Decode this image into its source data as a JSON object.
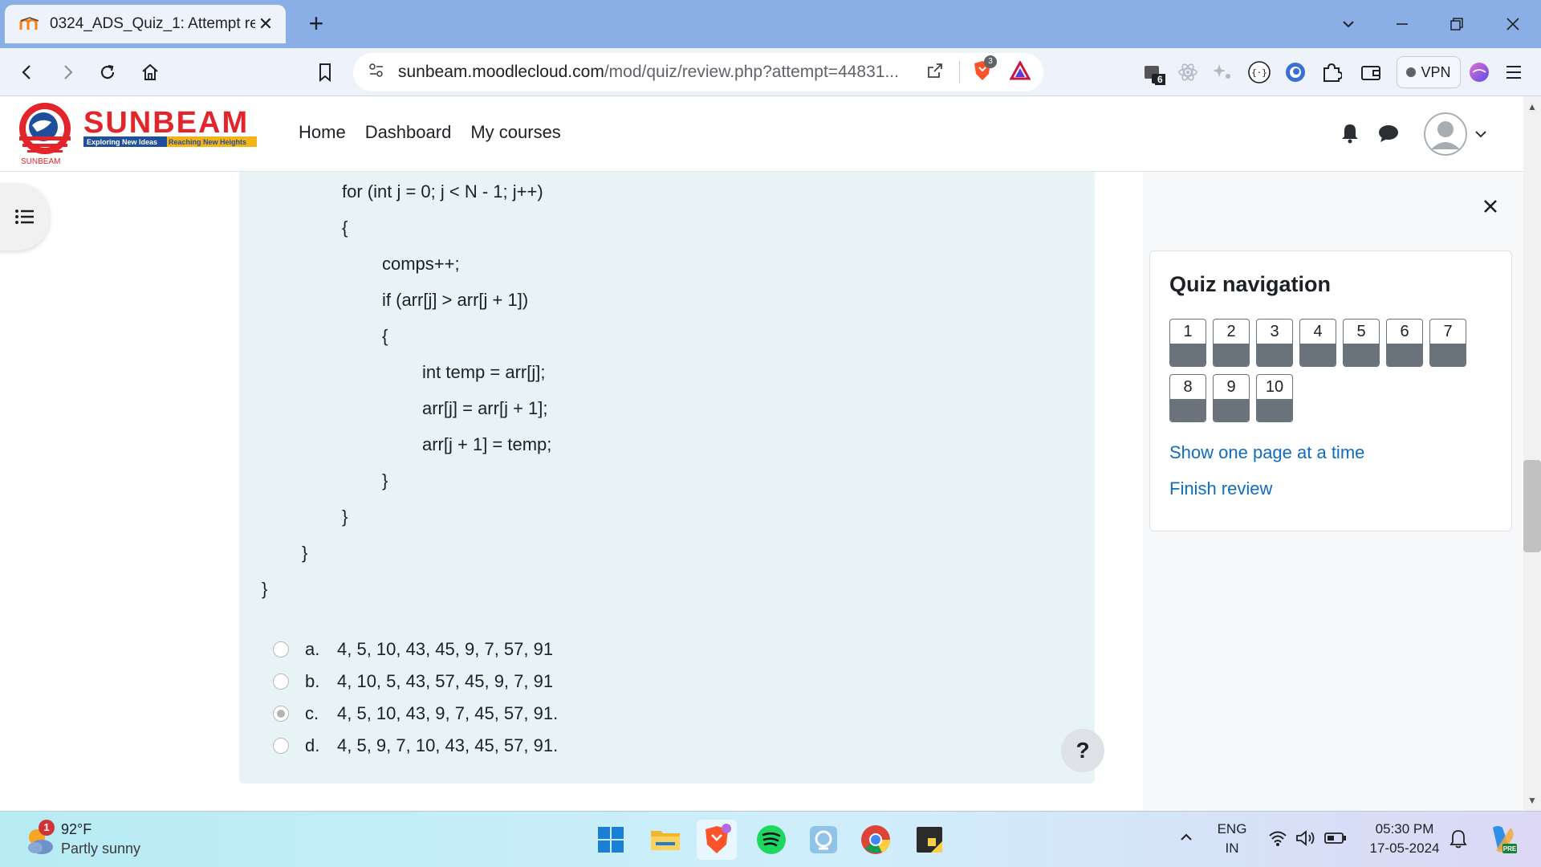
{
  "browser": {
    "tab_title": "0324_ADS_Quiz_1: Attempt revie",
    "url_host": "sunbeam.moodlecloud.com",
    "url_path": "/mod/quiz/review.php?attempt=44831...",
    "shield_badge": "3",
    "wallet_badge": "6",
    "vpn_label": "VPN"
  },
  "site": {
    "logo_text": "SUNBEAM",
    "logo_tagline_left": "Exploring New Ideas",
    "logo_tagline_right": "Reaching New Heights",
    "logo_small": "SUNBEAM",
    "nav": [
      "Home",
      "Dashboard",
      "My courses"
    ]
  },
  "question": {
    "code_lines": [
      "for (int j = 0; j < N - 1; j++)",
      "{",
      "comps++;",
      "if (arr[j] > arr[j + 1])",
      "{",
      "int temp = arr[j];",
      "arr[j] = arr[j + 1];",
      "arr[j + 1] = temp;",
      "}",
      "}",
      "}",
      "}"
    ],
    "answers": [
      {
        "letter": "a.",
        "text": "4, 5, 10, 43, 45, 9, 7, 57, 91",
        "checked": false
      },
      {
        "letter": "b.",
        "text": "4, 10, 5, 43, 57, 45, 9, 7, 91",
        "checked": false
      },
      {
        "letter": "c.",
        "text": "4, 5, 10, 43, 9, 7, 45, 57, 91.",
        "checked": true
      },
      {
        "letter": "d.",
        "text": "4, 5, 9, 7, 10, 43, 45, 57, 91.",
        "checked": false
      }
    ],
    "help_label": "?"
  },
  "quiz_navigation": {
    "title": "Quiz navigation",
    "buttons": [
      "1",
      "2",
      "3",
      "4",
      "5",
      "6",
      "7",
      "8",
      "9",
      "10"
    ],
    "show_one_page": "Show one page at a time",
    "finish_review": "Finish review"
  },
  "taskbar": {
    "weather_temp": "92°F",
    "weather_desc": "Partly sunny",
    "weather_badge": "1",
    "lang_top": "ENG",
    "lang_bottom": "IN",
    "time": "05:30 PM",
    "date": "17-05-2024"
  },
  "colors": {
    "accent_link": "#0f6cbf",
    "question_bg": "#e7f3f5",
    "nav_button_fill": "#6a737b",
    "logo_red": "#e3242b",
    "tab_strip": "#8aaee6"
  }
}
